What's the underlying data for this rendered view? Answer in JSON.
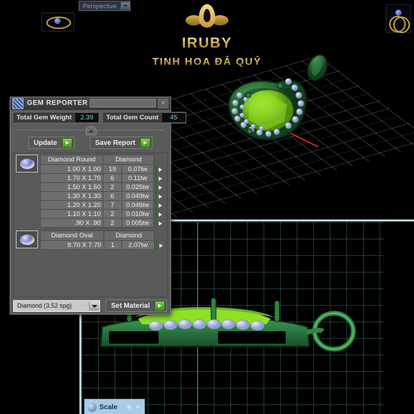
{
  "app": {
    "viewport_top_label": "Perspective",
    "viewport_dropdown_icon": "chevron-down-icon"
  },
  "brand": {
    "logo_icon": "flame-gem-logo",
    "name": "IRUBY",
    "tagline": "TINH HOA ĐÁ QUÝ",
    "gold": "#c8a03c"
  },
  "gem_reporter": {
    "title": "GEM REPORTER",
    "title_icon": "gem-panel-icon",
    "close_icon": "close-icon",
    "totals": [
      {
        "label": "Total Gem Weight",
        "value": "2.39"
      },
      {
        "label": "Total Gem Count",
        "value": "45"
      }
    ],
    "buttons": [
      {
        "label": "Update",
        "icon": "green-arrow-icon"
      },
      {
        "label": "Save Report",
        "icon": "green-arrow-icon"
      }
    ],
    "groups": [
      {
        "icon": "gem-round-icon",
        "headers": [
          "Diamond Round",
          "Diamond"
        ],
        "rows": [
          {
            "size": "1.00 X 1.00",
            "qty": "19",
            "weight": "0.07tw"
          },
          {
            "size": "1.70 X 1.70",
            "qty": "6",
            "weight": "0.11tw"
          },
          {
            "size": "1.50 X 1.50",
            "qty": "2",
            "weight": "0.025tw"
          },
          {
            "size": "1.30 X 1.30",
            "qty": "6",
            "weight": "0.049tw"
          },
          {
            "size": "1.20 X 1.20",
            "qty": "7",
            "weight": "0.046tw"
          },
          {
            "size": "1.10 X 1.10",
            "qty": "2",
            "weight": "0.010tw"
          },
          {
            "size": ".90 X .90",
            "qty": "2",
            "weight": "0.005tw"
          }
        ]
      },
      {
        "icon": "gem-oval-icon",
        "headers": [
          "Diamond Oval",
          "Diamond"
        ],
        "rows": [
          {
            "size": "8.70 X 7.70",
            "qty": "1",
            "weight": "2.07tw"
          }
        ]
      }
    ],
    "material_select": {
      "value": "Diamond    (3.52 spg)",
      "dropdown_icon": "chevron-down-icon"
    },
    "set_material_button": {
      "label": "Set Material",
      "icon": "green-arrow-icon"
    }
  },
  "scale_panel": {
    "icon": "scale-icon",
    "title": "Scale",
    "gear_icon": "gear-icon",
    "close_icon": "close-icon"
  },
  "thumbnails": [
    {
      "name": "ring-thumbnail-top-left"
    },
    {
      "name": "ring-thumbnail-top-right"
    },
    {
      "name": "pendant-thumbnail-right"
    }
  ],
  "viewports": [
    {
      "name": "perspective-viewport",
      "model": "green-pendant-3d"
    },
    {
      "name": "front-viewport",
      "model": "green-pendant-front"
    }
  ]
}
